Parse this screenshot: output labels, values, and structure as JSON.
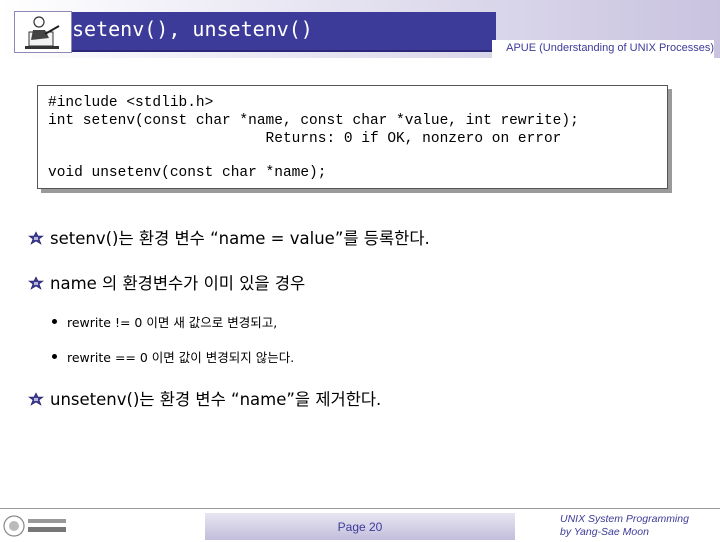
{
  "header": {
    "title": "setenv(), unsetenv()",
    "subtitle": "APUE (Understanding of UNIX Processes)"
  },
  "code": {
    "lines": [
      "#include <stdlib.h>",
      "int setenv(const char *name, const char *value, int rewrite);",
      "                         Returns: 0 if OK, nonzero on error",
      "void unsetenv(const char *name);"
    ]
  },
  "bullets": [
    {
      "text": "setenv()는 환경 변수 “name = value”를 등록한다."
    },
    {
      "text": "name 의 환경변수가 이미 있을 경우"
    },
    {
      "text": "unsetenv()는 환경 변수 “name”을 제거한다."
    }
  ],
  "sub_bullets": [
    {
      "text": "rewrite != 0 이면 새 값으로 변경되고,"
    },
    {
      "text": "rewrite == 0 이면 값이 변경되지 않는다."
    }
  ],
  "footer": {
    "page": "Page 20",
    "credit_line1": "UNIX System Programming",
    "credit_line2": "by Yang-Sae Moon"
  },
  "colors": {
    "brand": "#3d3b9a",
    "title_bg": "#3d3b9a"
  },
  "icons": {
    "bullet": "fleur-bullet-icon",
    "header_logo": "writer-clipart-icon",
    "footer_logo": "university-logo-icon"
  }
}
